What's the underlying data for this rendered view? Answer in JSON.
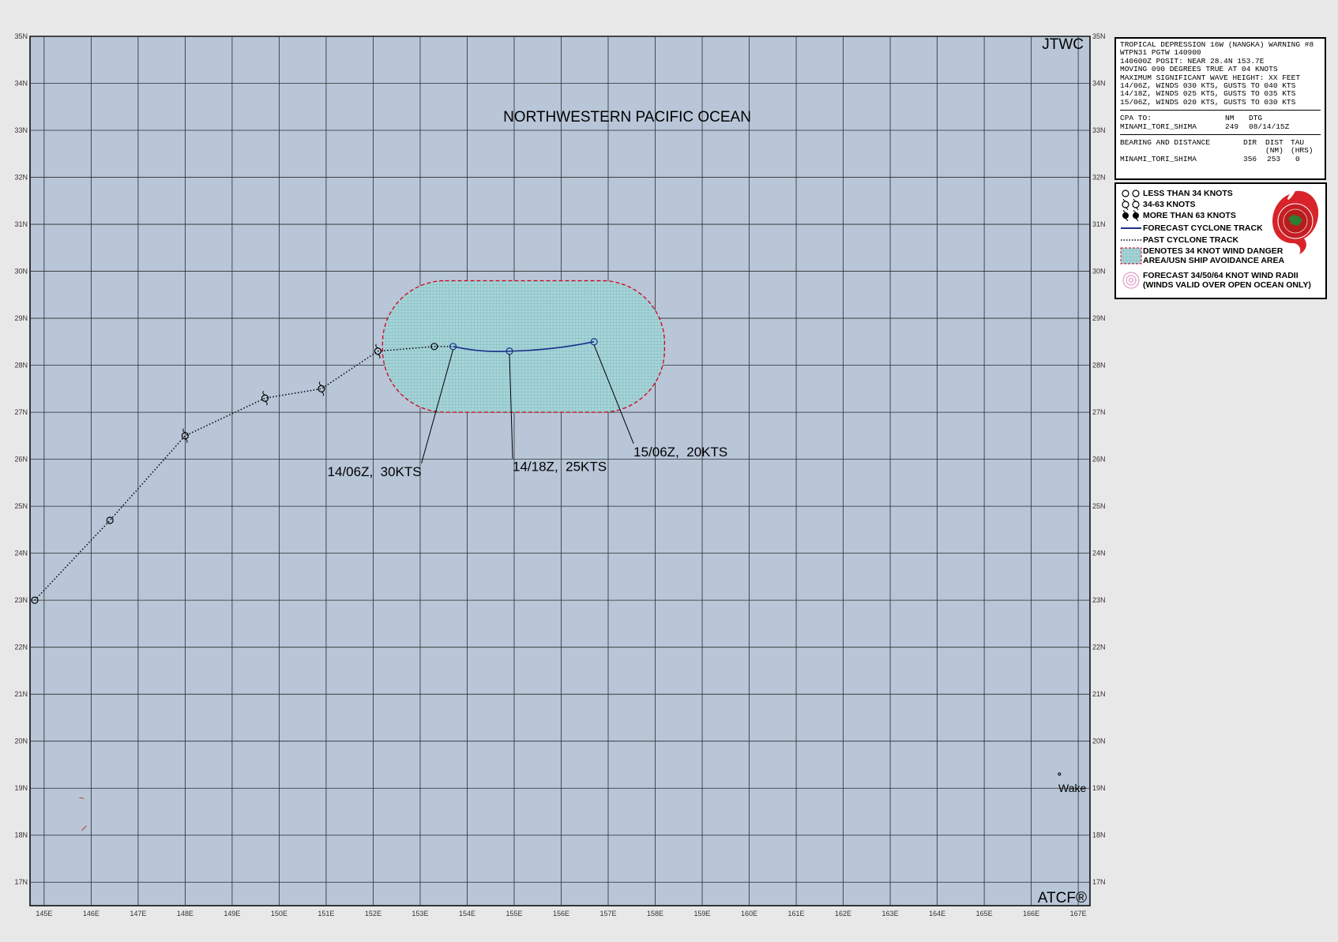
{
  "map": {
    "agency": "JTWC",
    "ocean_label": "NORTHWESTERN PACIFIC OCEAN",
    "credit": "ATCF®",
    "lat_labels": [
      "35N",
      "34N",
      "33N",
      "32N",
      "31N",
      "30N",
      "29N",
      "28N",
      "27N",
      "26N",
      "25N",
      "24N",
      "23N",
      "22N",
      "21N",
      "20N",
      "19N",
      "18N",
      "17N"
    ],
    "lon_labels": [
      "145E",
      "146E",
      "147E",
      "148E",
      "149E",
      "150E",
      "151E",
      "152E",
      "153E",
      "154E",
      "155E",
      "156E",
      "157E",
      "158E",
      "159E",
      "160E",
      "161E",
      "162E",
      "163E",
      "164E",
      "165E",
      "166E",
      "167E"
    ],
    "place_label": "Wake",
    "colors": {
      "ocean": "#b8c6d8",
      "grid": "#2b2b2b",
      "danger_fill": "#a8d4d8",
      "danger_border": "#d0021b",
      "forecast_track": "#1a2f8a",
      "past_track": "#000000"
    }
  },
  "track": {
    "past": [
      {
        "lat": 23.0,
        "lon": 144.8
      },
      {
        "lat": 24.7,
        "lon": 146.4
      },
      {
        "lat": 26.5,
        "lon": 148.0
      },
      {
        "lat": 27.3,
        "lon": 149.7
      },
      {
        "lat": 27.5,
        "lon": 150.9
      },
      {
        "lat": 28.3,
        "lon": 152.1
      },
      {
        "lat": 28.4,
        "lon": 153.3
      }
    ],
    "forecast": [
      {
        "lat": 28.4,
        "lon": 153.7,
        "label": "14/06Z,  30KTS"
      },
      {
        "lat": 28.3,
        "lon": 154.9,
        "label": "14/18Z,  25KTS"
      },
      {
        "lat": 28.5,
        "lon": 156.7,
        "label": "15/06Z,  20KTS"
      }
    ]
  },
  "warning": {
    "header": "TROPICAL DEPRESSION 16W (NANGKA) WARNING #8",
    "lines": [
      "WTPN31 PGTW 140900",
      "140600Z POSIT: NEAR 28.4N 153.7E",
      "MOVING 090 DEGREES TRUE AT 04 KNOTS",
      "MAXIMUM SIGNIFICANT WAVE HEIGHT: XX FEET",
      "14/06Z, WINDS 030 KTS, GUSTS TO 040 KTS",
      "14/18Z, WINDS 025 KTS, GUSTS TO 035 KTS",
      "15/06Z, WINDS 020 KTS, GUSTS TO 030 KTS"
    ],
    "cpa": {
      "title": "CPA TO:",
      "col_nm": "NM",
      "col_dtg": "DTG",
      "place": "MINAMI_TORI_SHIMA",
      "nm": "249",
      "dtg": "08/14/15Z"
    },
    "bearing": {
      "title": "BEARING AND DISTANCE",
      "col_dir": "DIR",
      "col_dist": "DIST",
      "col_tau": "TAU",
      "col_dist_unit": "(NM)",
      "col_tau_unit": "(HRS)",
      "place": "MINAMI_TORI_SHIMA",
      "dir": "356",
      "dist": "253",
      "tau": "0"
    }
  },
  "legend": {
    "items": [
      {
        "label": "LESS THAN 34 KNOTS",
        "icon": "open-circle-icon"
      },
      {
        "label": "34-63 KNOTS",
        "icon": "cyclone-open-icon"
      },
      {
        "label": "MORE THAN 63 KNOTS",
        "icon": "cyclone-filled-icon"
      },
      {
        "label": "FORECAST CYCLONE TRACK",
        "icon": "forecast-track-line-icon"
      },
      {
        "label": "PAST CYCLONE TRACK",
        "icon": "past-track-dotted-icon"
      },
      {
        "label": "DENOTES 34 KNOT WIND DANGER\nAREA/USN SHIP AVOIDANCE AREA",
        "icon": "danger-area-swatch-icon"
      },
      {
        "label": "FORECAST 34/50/64 KNOT WIND RADII\n(WINDS VALID OVER OPEN OCEAN ONLY)",
        "icon": "wind-radii-icon"
      }
    ]
  }
}
